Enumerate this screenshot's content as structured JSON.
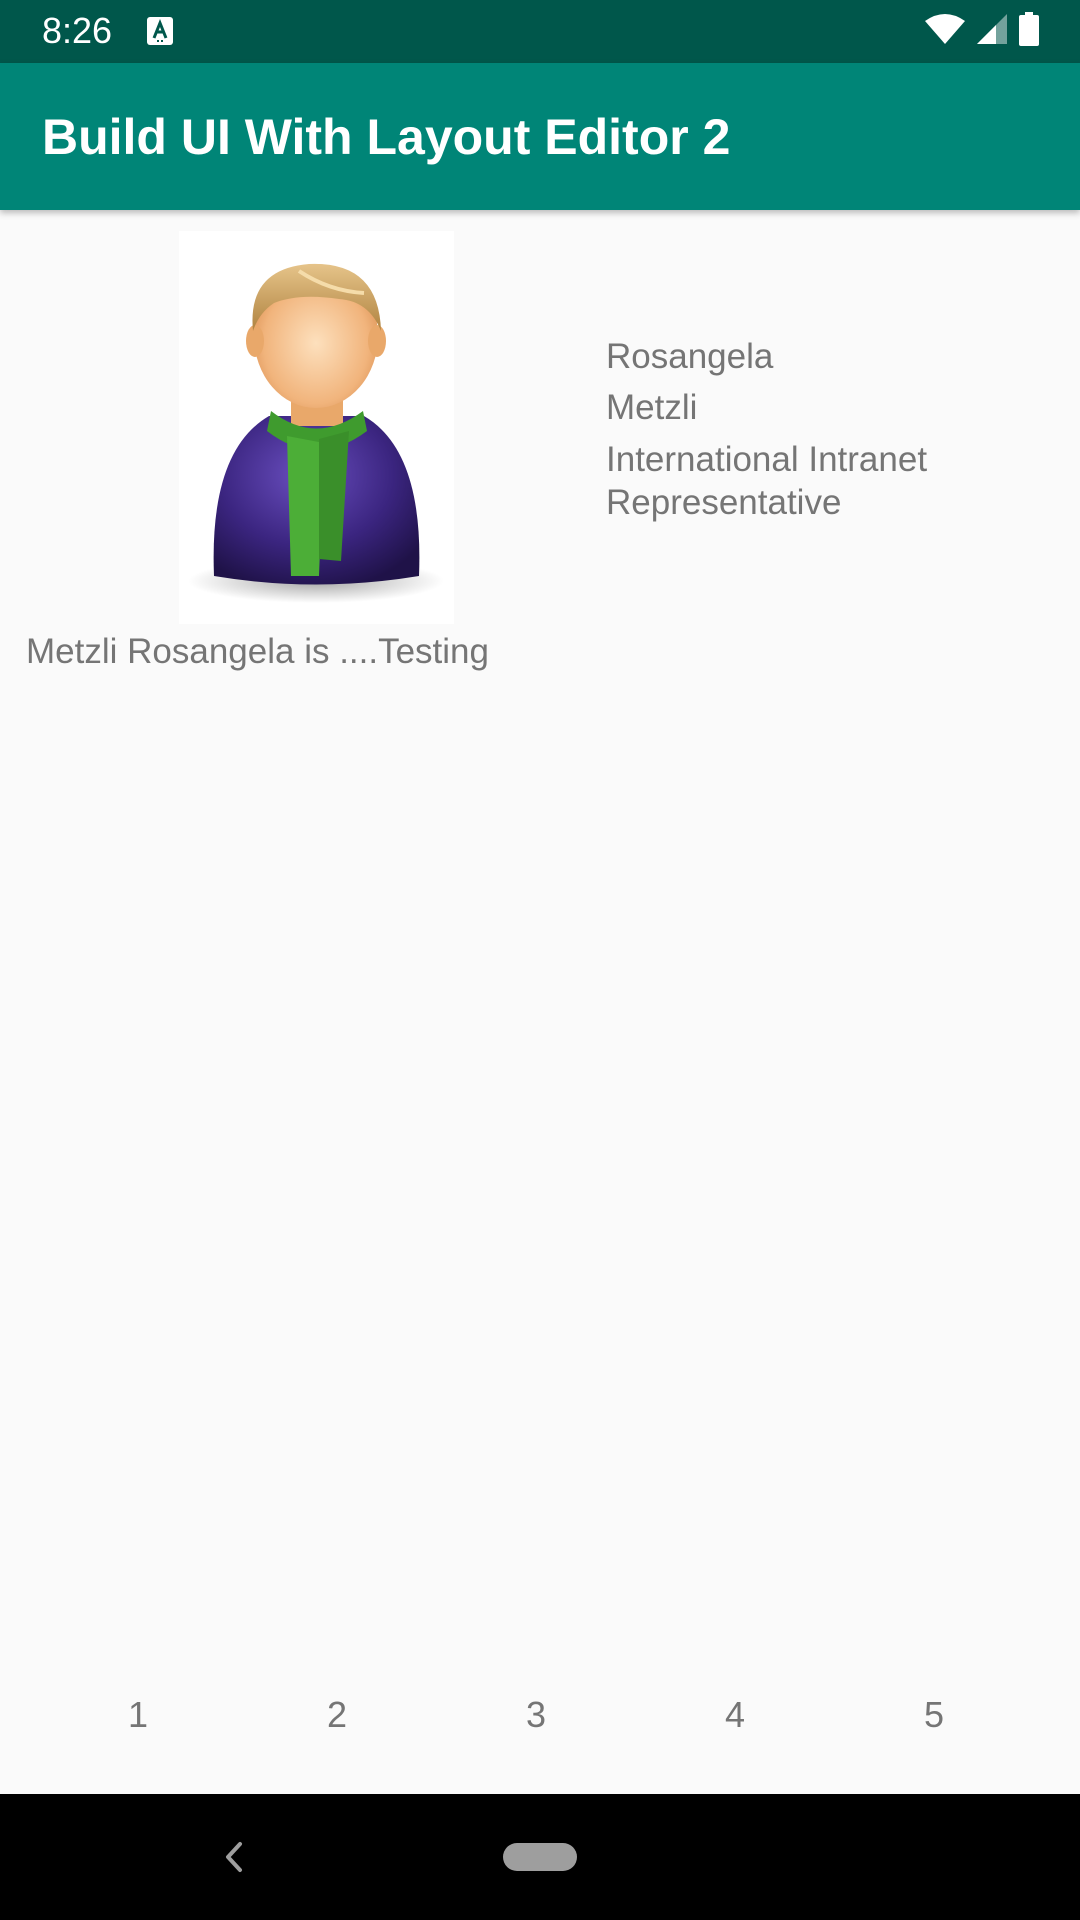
{
  "status_bar": {
    "time": "8:26",
    "icons": [
      "keyboard-a-icon",
      "wifi-icon",
      "signal-icon",
      "battery-icon"
    ],
    "background": "#00574b"
  },
  "app_bar": {
    "title": "Build UI With Layout Editor 2",
    "background": "#008577"
  },
  "profile": {
    "avatar_icon": "person-avatar-icon",
    "first_name": "Rosangela",
    "last_name": "Metzli",
    "job_title": "International Intranet Representative",
    "description": "Metzli Rosangela is ....Testing"
  },
  "number_row": {
    "items": [
      "1",
      "2",
      "3",
      "4",
      "5"
    ]
  },
  "nav_bar": {
    "icons": [
      "back-icon",
      "home-pill-icon"
    ]
  }
}
